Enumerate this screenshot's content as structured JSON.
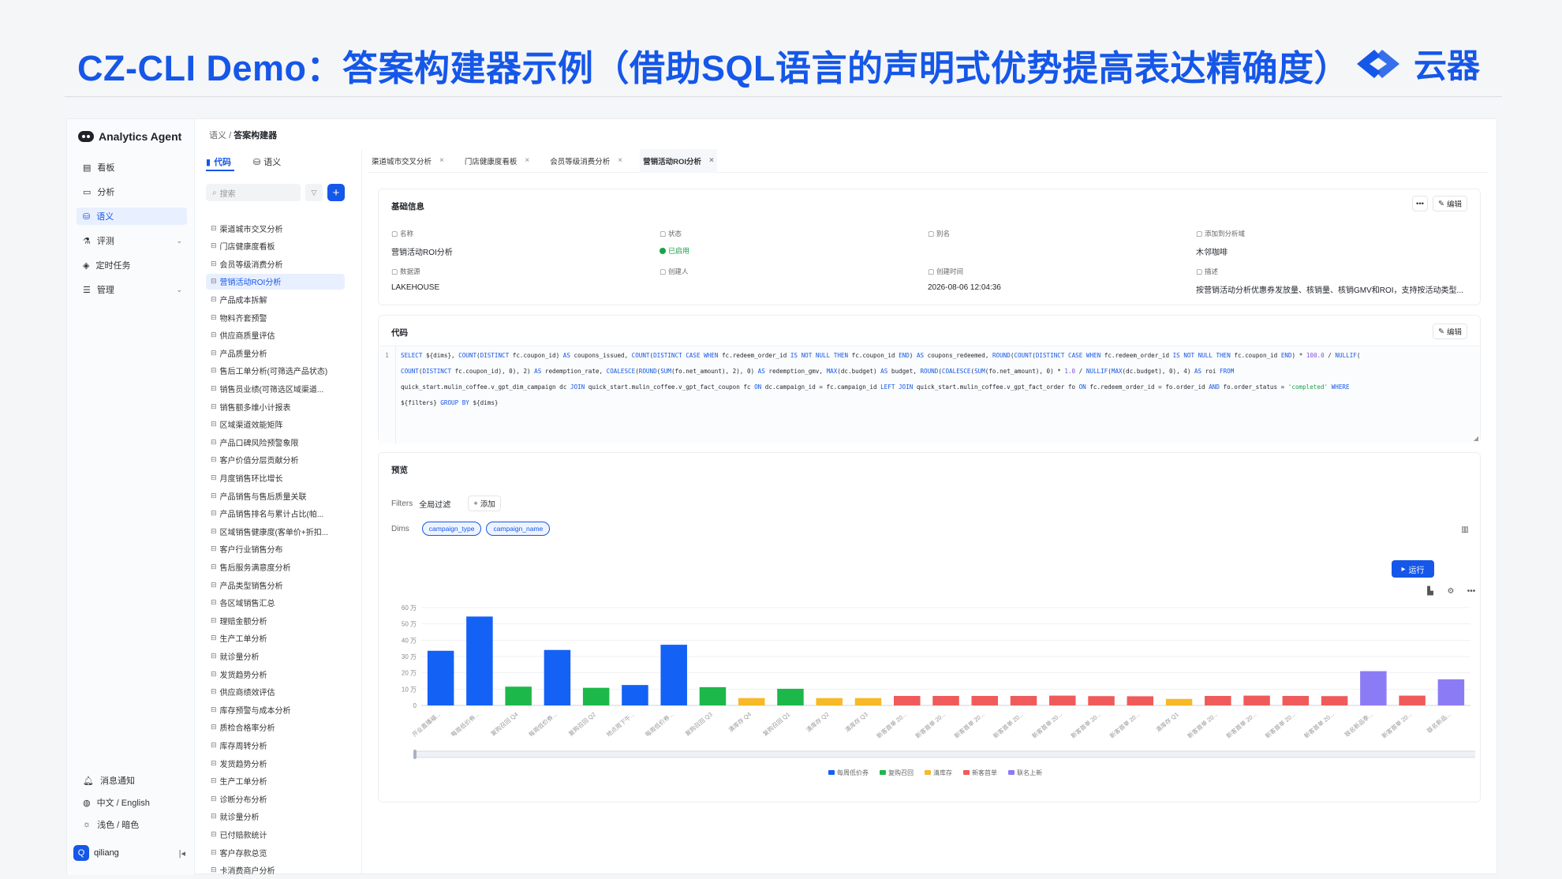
{
  "slide_title": "CZ-CLI Demo：答案构建器示例（借助SQL语言的声明式优势提高表达精确度）",
  "brand_name": "云器",
  "app_name": "Analytics Agent",
  "nav": [
    {
      "label": "看板",
      "icon": "dashboard-icon",
      "active": false
    },
    {
      "label": "分析",
      "icon": "chat-icon",
      "active": false
    },
    {
      "label": "语义",
      "icon": "database-icon",
      "active": true
    },
    {
      "label": "评测",
      "icon": "flask-icon",
      "active": false,
      "expandable": true
    },
    {
      "label": "定时任务",
      "icon": "cube-icon",
      "active": false
    },
    {
      "label": "管理",
      "icon": "server-icon",
      "active": false,
      "expandable": true
    }
  ],
  "nav_footer": {
    "notifications": "消息通知",
    "language": "中文 / English",
    "theme": "浅色 / 暗色"
  },
  "user": {
    "name": "qiliang",
    "avatar": "Q"
  },
  "breadcrumb": {
    "parent": "语义",
    "separator": "/",
    "current": "答案构建器"
  },
  "panel_tabs": {
    "code": "代码",
    "semantic": "语义"
  },
  "search": {
    "placeholder": "搜索"
  },
  "tree_items": [
    "渠道城市交叉分析",
    "门店健康度看板",
    "会员等级消费分析",
    "营销活动ROI分析",
    "产品成本拆解",
    "物料齐套预警",
    "供应商质量评估",
    "产品质量分析",
    "售后工单分析(可筛选产品状态)",
    "销售员业绩(可筛选区域渠道...",
    "销售额多维小计报表",
    "区域渠道效能矩阵",
    "产品口碑风险预警象限",
    "客户价值分层贡献分析",
    "月度销售环比增长",
    "产品销售与售后质量关联",
    "产品销售排名与累计占比(帕...",
    "区域销售健康度(客单价+折扣...",
    "客户行业销售分布",
    "售后服务满意度分析",
    "产品类型销售分析",
    "各区域销售汇总",
    "理赔金额分析",
    "生产工单分析",
    "就诊量分析",
    "发货趋势分析",
    "供应商绩效评估",
    "库存预警与成本分析",
    "质检合格率分析",
    "库存周转分析",
    "发货趋势分析",
    "生产工单分析",
    "诊断分布分析",
    "就诊量分析",
    "已付赔款统计",
    "客户存款总览",
    "卡消费商户分析"
  ],
  "tree_active_index": 3,
  "file_tabs": [
    {
      "label": "渠道城市交叉分析",
      "active": false
    },
    {
      "label": "门店健康度看板",
      "active": false
    },
    {
      "label": "会员等级消费分析",
      "active": false
    },
    {
      "label": "营销活动ROI分析",
      "active": true
    }
  ],
  "basic_info": {
    "title": "基础信息",
    "more": "•••",
    "edit_label": "编辑",
    "fields": [
      {
        "label": "名称",
        "value": "营销活动ROI分析"
      },
      {
        "label": "状态",
        "value": "已启用"
      },
      {
        "label": "别名",
        "value": ""
      },
      {
        "label": "添加到分析域",
        "value": "木邻咖啡"
      },
      {
        "label": "数据源",
        "value": "LAKEHOUSE"
      },
      {
        "label": "创建人",
        "value": ""
      },
      {
        "label": "创建时间",
        "value": "2026-08-06 12:04:36"
      },
      {
        "label": "描述",
        "value": "按营销活动分析优惠券发放量、核销量、核销GMV和ROI，支持按活动类型..."
      }
    ]
  },
  "code_card": {
    "title": "代码",
    "edit_label": "编辑",
    "line_number": "1",
    "lines": [
      "SELECT ${dims}, COUNT(DISTINCT fc.coupon_id) AS coupons_issued, COUNT(DISTINCT CASE WHEN fc.redeem_order_id IS NOT NULL THEN fc.coupon_id END) AS coupons_redeemed, ROUND(COUNT(DISTINCT CASE WHEN fc.redeem_order_id IS NOT NULL THEN fc.coupon_id END) * 100.0 / NULLIF(",
      "COUNT(DISTINCT fc.coupon_id), 0), 2) AS redemption_rate, COALESCE(ROUND(SUM(fo.net_amount), 2), 0) AS redemption_gmv, MAX(dc.budget) AS budget, ROUND(COALESCE(SUM(fo.net_amount), 0) * 1.0 / NULLIF(MAX(dc.budget), 0), 4) AS roi FROM",
      "quick_start.mulin_coffee.v_gpt_dim_campaign dc JOIN quick_start.mulin_coffee.v_gpt_fact_coupon fc ON dc.campaign_id = fc.campaign_id LEFT JOIN quick_start.mulin_coffee.v_gpt_fact_order fo ON fc.redeem_order_id = fo.order_id AND fo.order_status = 'completed' WHERE",
      "${filters} GROUP BY ${dims}"
    ]
  },
  "preview": {
    "title": "预览",
    "filters_label": "Filters",
    "global_filter": "全局过滤",
    "add_label": "添加",
    "dims_label": "Dims",
    "dims": [
      "campaign_type",
      "campaign_name"
    ],
    "run_label": "运行"
  },
  "chart_data": {
    "type": "bar",
    "ylim": [
      0,
      600000
    ],
    "y_ticks": [
      "0",
      "10 万",
      "20 万",
      "30 万",
      "40 万",
      "50 万",
      "60 万"
    ],
    "legend": [
      {
        "name": "每周低价券",
        "color": "#1361f5"
      },
      {
        "name": "复购召回",
        "color": "#1db84a"
      },
      {
        "name": "清库存",
        "color": "#f7b928"
      },
      {
        "name": "新客首单",
        "color": "#f05a5a"
      },
      {
        "name": "联名上新",
        "color": "#8b7cf6"
      }
    ],
    "bars": [
      {
        "label": "开业直播福...",
        "value": 335000,
        "series": 0
      },
      {
        "label": "每周低价券...",
        "value": 545000,
        "series": 0
      },
      {
        "label": "复购召回 Q4",
        "value": 115000,
        "series": 1
      },
      {
        "label": "每周低价券...",
        "value": 340000,
        "series": 0
      },
      {
        "label": "复购召回 Q2",
        "value": 108000,
        "series": 1
      },
      {
        "label": "地点周下午...",
        "value": 125000,
        "series": 0
      },
      {
        "label": "每周低价券...",
        "value": 372000,
        "series": 0
      },
      {
        "label": "复购召回 Q3",
        "value": 112000,
        "series": 1
      },
      {
        "label": "清库存 Q4",
        "value": 45000,
        "series": 2
      },
      {
        "label": "复购召回 Q1",
        "value": 102000,
        "series": 1
      },
      {
        "label": "清库存 Q2",
        "value": 45000,
        "series": 2
      },
      {
        "label": "清库存 Q3",
        "value": 45000,
        "series": 2
      },
      {
        "label": "新客首单 20...",
        "value": 58000,
        "series": 3
      },
      {
        "label": "新客首单 20...",
        "value": 58000,
        "series": 3
      },
      {
        "label": "新客首单 20...",
        "value": 58000,
        "series": 3
      },
      {
        "label": "新客首单 20...",
        "value": 58000,
        "series": 3
      },
      {
        "label": "新客首单 20...",
        "value": 60000,
        "series": 3
      },
      {
        "label": "新客首单 20...",
        "value": 57000,
        "series": 3
      },
      {
        "label": "新客首单 20...",
        "value": 56000,
        "series": 3
      },
      {
        "label": "清库存 Q1",
        "value": 40000,
        "series": 2
      },
      {
        "label": "新客首单 20...",
        "value": 58000,
        "series": 3
      },
      {
        "label": "新客首单 20...",
        "value": 60000,
        "series": 3
      },
      {
        "label": "新客首单 20...",
        "value": 58000,
        "series": 3
      },
      {
        "label": "新客首单 20...",
        "value": 57000,
        "series": 3
      },
      {
        "label": "联名新品季...",
        "value": 210000,
        "series": 4
      },
      {
        "label": "新客首单 20...",
        "value": 60000,
        "series": 3
      },
      {
        "label": "联名新品...",
        "value": 160000,
        "series": 4
      }
    ]
  }
}
